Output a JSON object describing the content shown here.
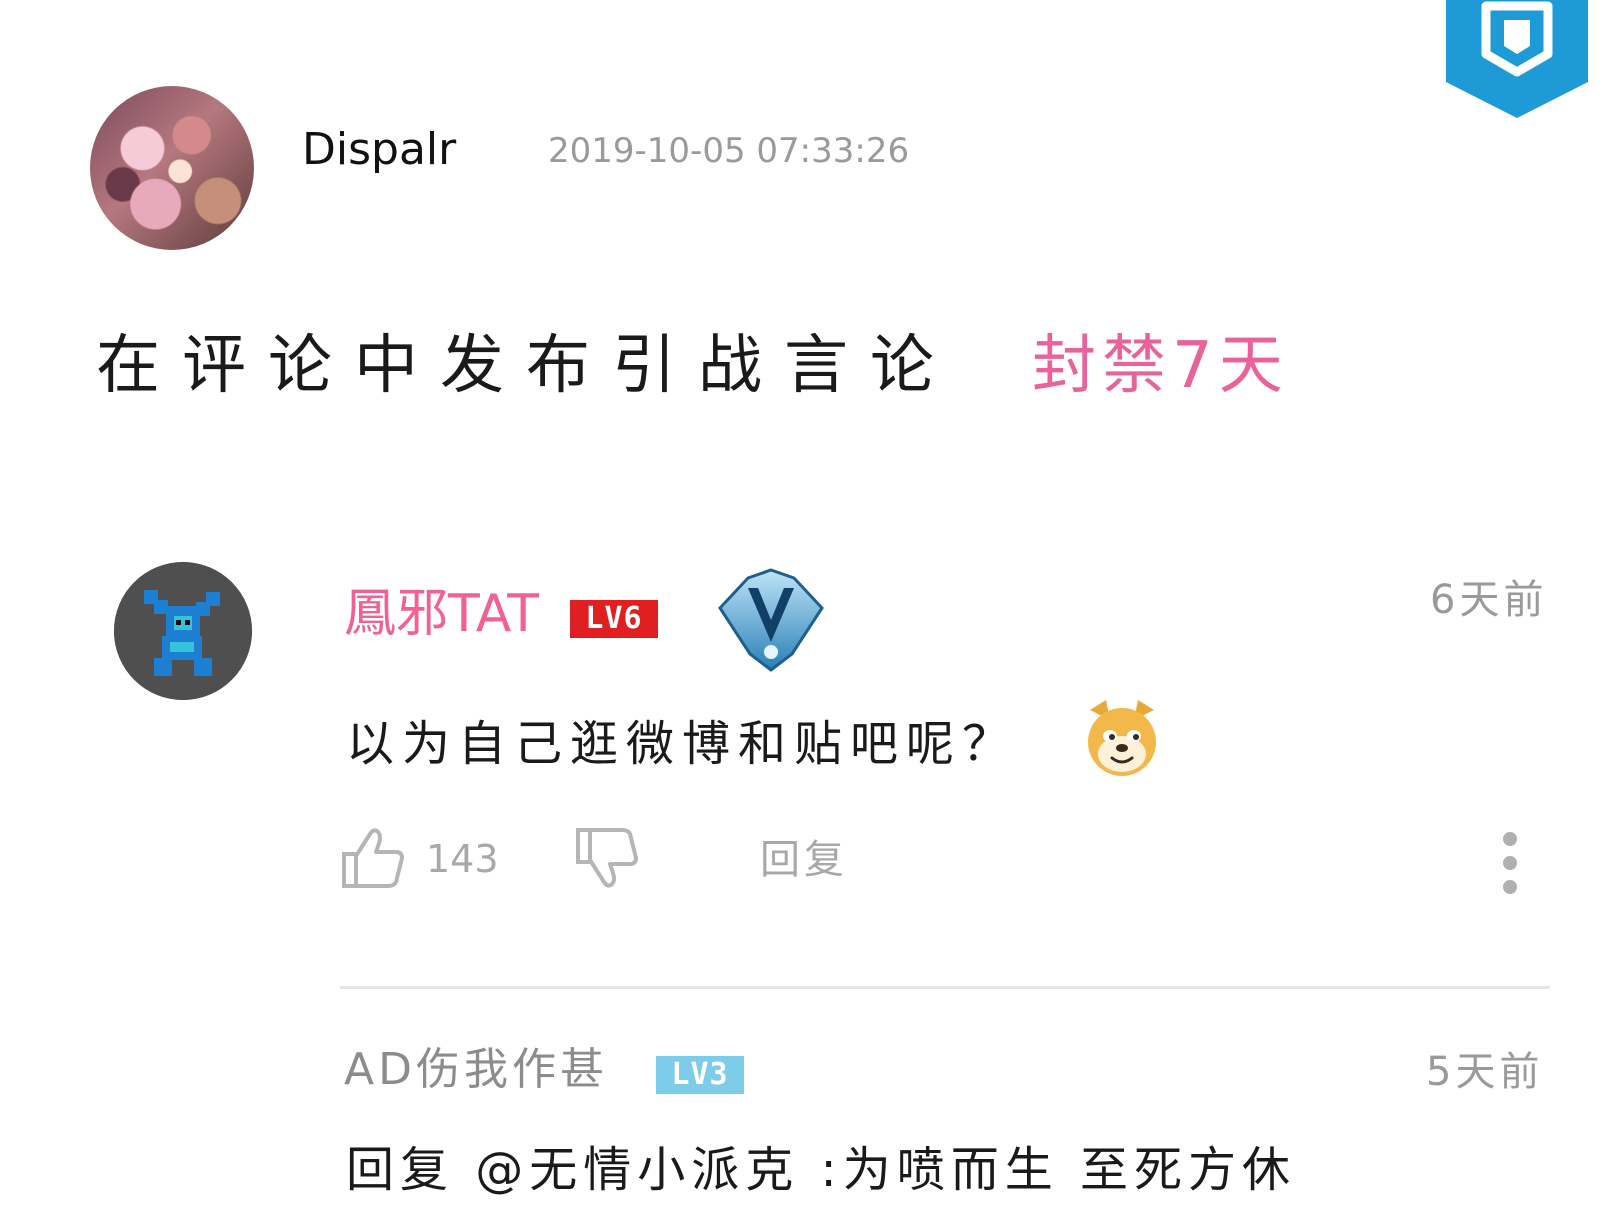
{
  "ban_notice": {
    "username": "Dispalr",
    "timestamp": "2019-10-05 07:33:26",
    "reason": "在评论中发布引战言论",
    "penalty": "封禁7天",
    "penalty_color": "#e9629a",
    "avatar_icon": "anime-girl-avatar"
  },
  "header_badge": {
    "icon": "shield-icon",
    "color": "#1e9ad6"
  },
  "comment": {
    "username": "鳳邪TAT",
    "username_color": "#f06292",
    "level": "LV6",
    "level_color": "#e02020",
    "medal_icon": "vip-medal-icon",
    "time": "6天前",
    "text": "以为自己逛微博和贴吧呢？",
    "emoji": "doge-emoji",
    "likes": "143",
    "reply_label": "回复",
    "avatar_icon": "pixel-robot-avatar"
  },
  "reply": {
    "username": "AD伤我作甚",
    "level": "LV3",
    "level_color": "#7ecde8",
    "time": "5天前",
    "text": "回复 @无情小派克 :为喷而生 至死方休"
  }
}
